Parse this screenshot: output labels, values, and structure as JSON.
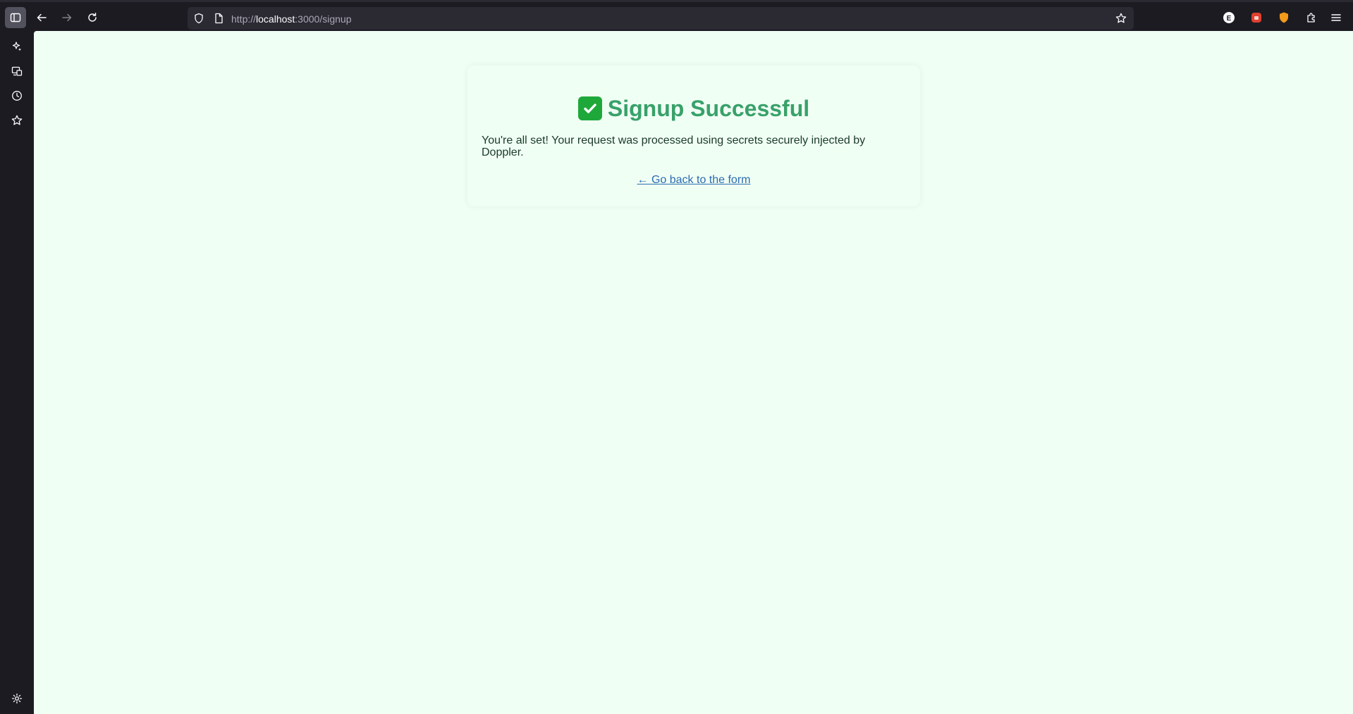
{
  "browser": {
    "url_scheme": "http://",
    "url_host": "localhost",
    "url_path": ":3000/signup"
  },
  "page": {
    "heading": "Signup Successful",
    "message": "You're all set! Your request was processed using secrets securely injected by Doppler.",
    "back_link": "← Go back to the form"
  },
  "colors": {
    "page_background": "#f0fff4",
    "heading": "#38a169",
    "link": "#2b6cb0"
  }
}
